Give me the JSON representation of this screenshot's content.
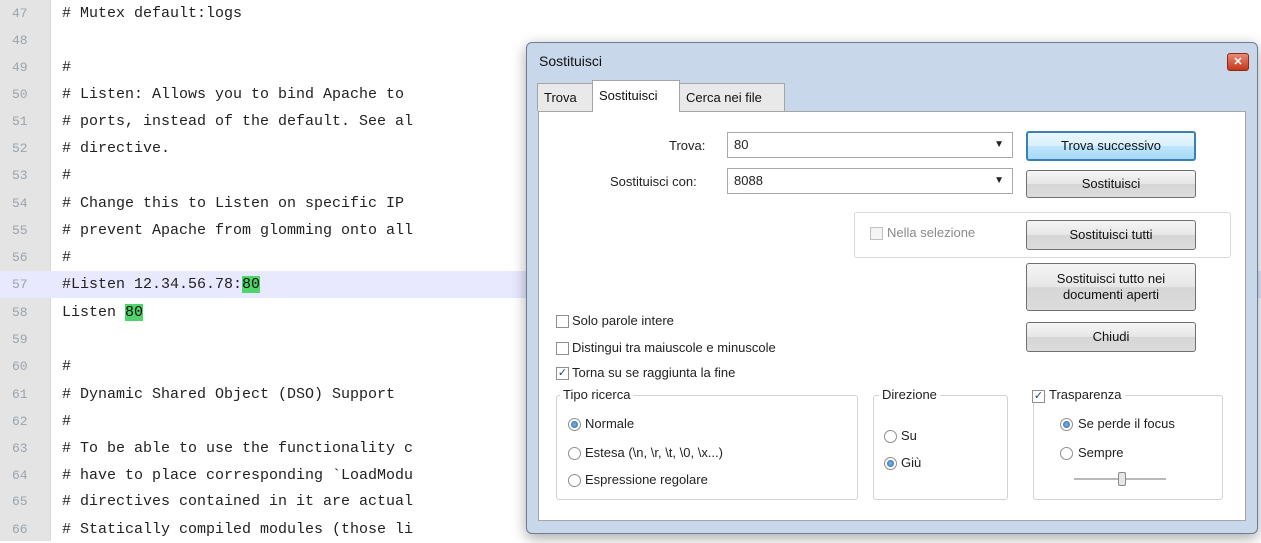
{
  "editor": {
    "lines": [
      {
        "num": "47",
        "text": "# Mutex default:logs"
      },
      {
        "num": "48",
        "text": ""
      },
      {
        "num": "49",
        "text": "#"
      },
      {
        "num": "50",
        "text": "# Listen: Allows you to bind Apache to"
      },
      {
        "num": "51",
        "text": "# ports, instead of the default. See al"
      },
      {
        "num": "52",
        "text": "# directive."
      },
      {
        "num": "53",
        "text": "#"
      },
      {
        "num": "54",
        "text": "# Change this to Listen on specific IP"
      },
      {
        "num": "55",
        "text": "# prevent Apache from glomming onto all"
      },
      {
        "num": "56",
        "text": "#"
      },
      {
        "num": "57",
        "text": "#Listen 12.34.56.78:",
        "match": "80"
      },
      {
        "num": "58",
        "text": "Listen ",
        "match": "80"
      },
      {
        "num": "59",
        "text": ""
      },
      {
        "num": "60",
        "text": "#"
      },
      {
        "num": "61",
        "text": "# Dynamic Shared Object (DSO) Support"
      },
      {
        "num": "62",
        "text": "#"
      },
      {
        "num": "63",
        "text": "# To be able to use the functionality c"
      },
      {
        "num": "64",
        "text": "# have to place corresponding `LoadModu"
      },
      {
        "num": "65",
        "text": "# directives contained in it are actual"
      },
      {
        "num": "66",
        "text": "# Statically compiled modules (those li"
      }
    ],
    "highlight_color": "#4fd46a",
    "current_line_color": "#e8e8ff"
  },
  "dialog": {
    "title": "Sostituisci",
    "close_icon": "close-icon",
    "tabs": [
      "Trova",
      "Sostituisci",
      "Cerca nei file"
    ],
    "active_tab": "Sostituisci",
    "find_label": "Trova:",
    "find_value": "80",
    "replace_label": "Sostituisci con:",
    "replace_value": "8088",
    "in_selection_label": "Nella selezione",
    "buttons": {
      "find_next": "Trova successivo",
      "replace": "Sostituisci",
      "replace_all": "Sostituisci tutti",
      "replace_all_open_line1": "Sostituisci tutto nei",
      "replace_all_open_line2": "documenti aperti",
      "close": "Chiudi"
    },
    "options": {
      "whole_word": "Solo parole intere",
      "match_case": "Distingui tra maiuscole e minuscole",
      "wrap_around": "Torna su se raggiunta la fine"
    },
    "search_mode": {
      "label": "Tipo ricerca",
      "normal": "Normale",
      "extended": "Estesa (\\n, \\r, \\t, \\0, \\x...)",
      "regex": "Espressione regolare"
    },
    "direction": {
      "label": "Direzione",
      "up": "Su",
      "down": "Giù"
    },
    "transparency": {
      "label": "Trasparenza",
      "on_lose_focus": "Se perde il focus",
      "always": "Sempre"
    }
  }
}
